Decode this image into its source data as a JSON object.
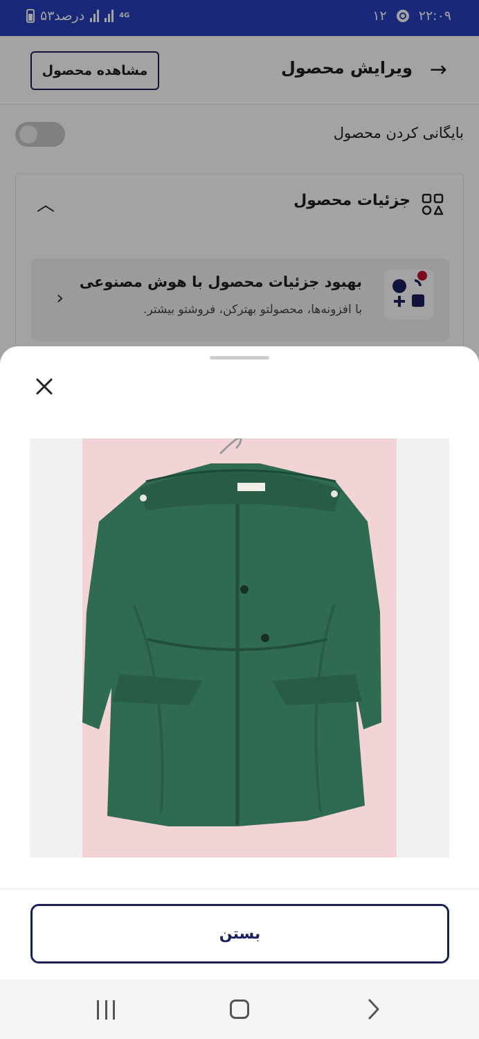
{
  "status_bar": {
    "battery_text": "۵۳درصد",
    "network": "4G",
    "notification_count": "۱۲",
    "time": "۲۲:۰۹"
  },
  "header": {
    "title": "ویرایش محصول",
    "view_product_label": "مشاهده محصول"
  },
  "archive": {
    "label": "بایگانی کردن محصول",
    "enabled": false
  },
  "product_details": {
    "title": "جزئیات محصول",
    "ai_banner": {
      "title": "بهبود جزئیات محصول با هوش مصنوعی",
      "subtitle": "با افزونه‌ها، محصولتو بهترکن، فروشتو بیشتر."
    }
  },
  "sheet": {
    "image_description": "green hooded jacket on hanger",
    "close_button_label": "بستن"
  },
  "colors": {
    "status_bar": "#2a3fbf",
    "primary_navy": "#1b1f5c",
    "jacket_green": "#2f6b51",
    "photo_background": "#f3d4d6"
  },
  "icons": {
    "back": "arrow-right-icon",
    "section": "shapes-icon",
    "collapse": "chevron-up-icon",
    "banner_chevron": "chevron-left-icon",
    "close": "close-icon"
  }
}
